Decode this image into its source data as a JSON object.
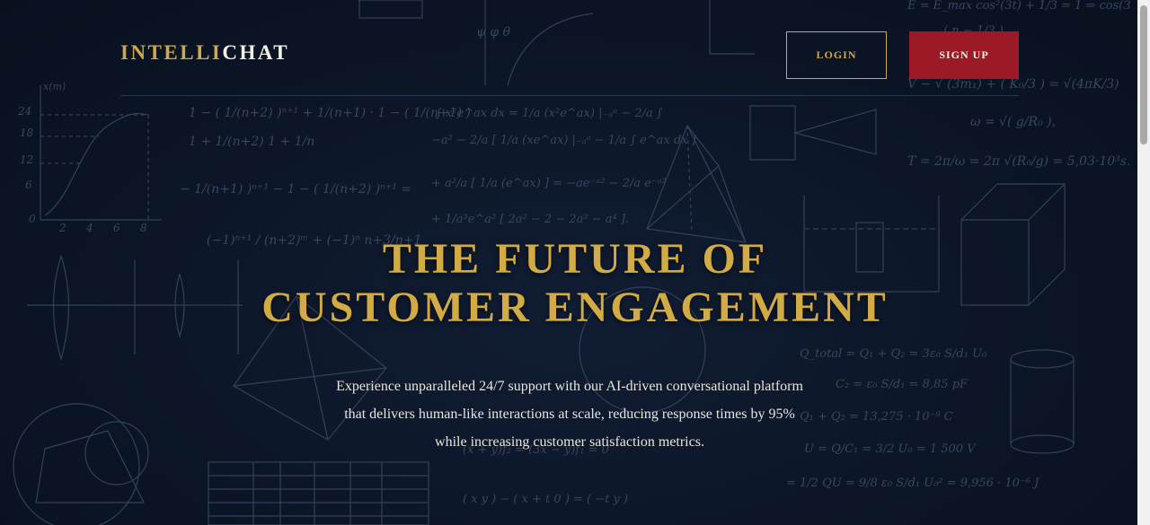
{
  "header": {
    "logo_part1": "INTELLI",
    "logo_part2": "CHAT",
    "login_label": "LOGIN",
    "signup_label": "SIGN UP"
  },
  "hero": {
    "title_line1": "THE FUTURE OF",
    "title_line2": "CUSTOMER ENGAGEMENT",
    "subtitle_line1": "Experience unparalleled 24/7 support with our AI-driven conversational platform",
    "subtitle_line2": "that delivers human-like interactions at scale, reducing response times by 95%",
    "subtitle_line3": "while increasing customer satisfaction metrics."
  },
  "colors": {
    "background": "#0b1526",
    "gold": "#d2ab45",
    "signup_red": "#9b1a25",
    "text": "#e9e6dc"
  }
}
